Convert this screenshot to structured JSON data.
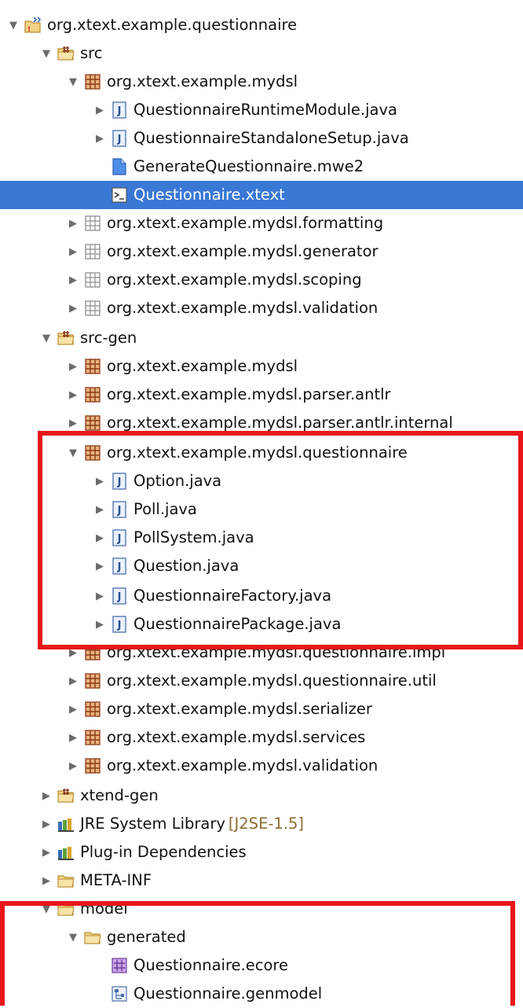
{
  "tree": {
    "project": "org.xtext.example.questionnaire",
    "src": {
      "label": "src",
      "pkg_mydsl": "org.xtext.example.mydsl",
      "files": [
        "QuestionnaireRuntimeModule.java",
        "QuestionnaireStandaloneSetup.java",
        "GenerateQuestionnaire.mwe2",
        "Questionnaire.xtext"
      ],
      "packages": [
        "org.xtext.example.mydsl.formatting",
        "org.xtext.example.mydsl.generator",
        "org.xtext.example.mydsl.scoping",
        "org.xtext.example.mydsl.validation"
      ]
    },
    "src_gen": {
      "label": "src-gen",
      "packages_before": [
        "org.xtext.example.mydsl",
        "org.xtext.example.mydsl.parser.antlr",
        "org.xtext.example.mydsl.parser.antlr.internal"
      ],
      "questionnaire_pkg": "org.xtext.example.mydsl.questionnaire",
      "questionnaire_files": [
        "Option.java",
        "Poll.java",
        "PollSystem.java",
        "Question.java",
        "QuestionnaireFactory.java",
        "QuestionnairePackage.java"
      ],
      "packages_after": [
        "org.xtext.example.mydsl.questionnaire.impl",
        "org.xtext.example.mydsl.questionnaire.util",
        "org.xtext.example.mydsl.serializer",
        "org.xtext.example.mydsl.services",
        "org.xtext.example.mydsl.validation"
      ]
    },
    "xtend_gen": "xtend-gen",
    "jre": {
      "label": "JRE System Library",
      "suffix": "[J2SE-1.5]"
    },
    "plugin_deps": "Plug-in Dependencies",
    "meta_inf": "META-INF",
    "model": {
      "label": "model",
      "generated": "generated",
      "files": [
        "Questionnaire.ecore",
        "Questionnaire.genmodel"
      ]
    }
  },
  "selected_item": "Questionnaire.xtext",
  "colors": {
    "selection": "#3a78d6",
    "highlight_box": "#e8161a",
    "folder": "#e9c66a",
    "package": "#a0522d"
  }
}
